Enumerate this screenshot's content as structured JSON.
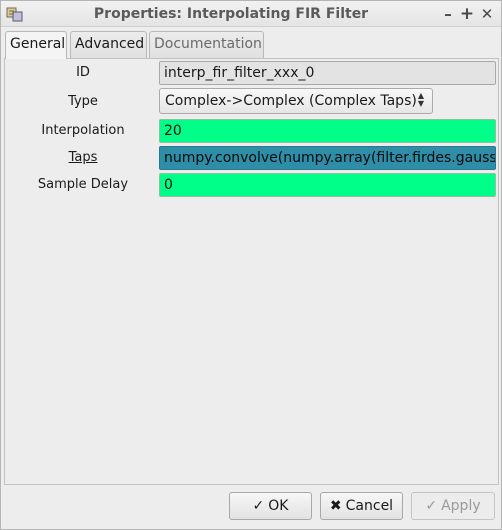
{
  "window": {
    "title": "Properties: Interpolating FIR Filter"
  },
  "tabs": [
    {
      "label": "General",
      "active": true
    },
    {
      "label": "Advanced",
      "active": false
    },
    {
      "label": "Documentation",
      "active": false
    }
  ],
  "form": {
    "id": {
      "label": "ID",
      "value": "interp_fir_filter_xxx_0"
    },
    "type": {
      "label": "Type",
      "selected": "Complex->Complex (Complex Taps)"
    },
    "interpolation": {
      "label": "Interpolation",
      "value": "20"
    },
    "taps": {
      "label": "Taps",
      "value": "numpy.convolve(numpy.array(filter.firdes.gaussia"
    },
    "sample_delay": {
      "label": "Sample Delay",
      "value": "0"
    }
  },
  "buttons": {
    "ok": "OK",
    "cancel": "Cancel",
    "apply": "Apply"
  },
  "colors": {
    "valid_field": "#00ff88",
    "taps_field": "#2e8ea8"
  }
}
